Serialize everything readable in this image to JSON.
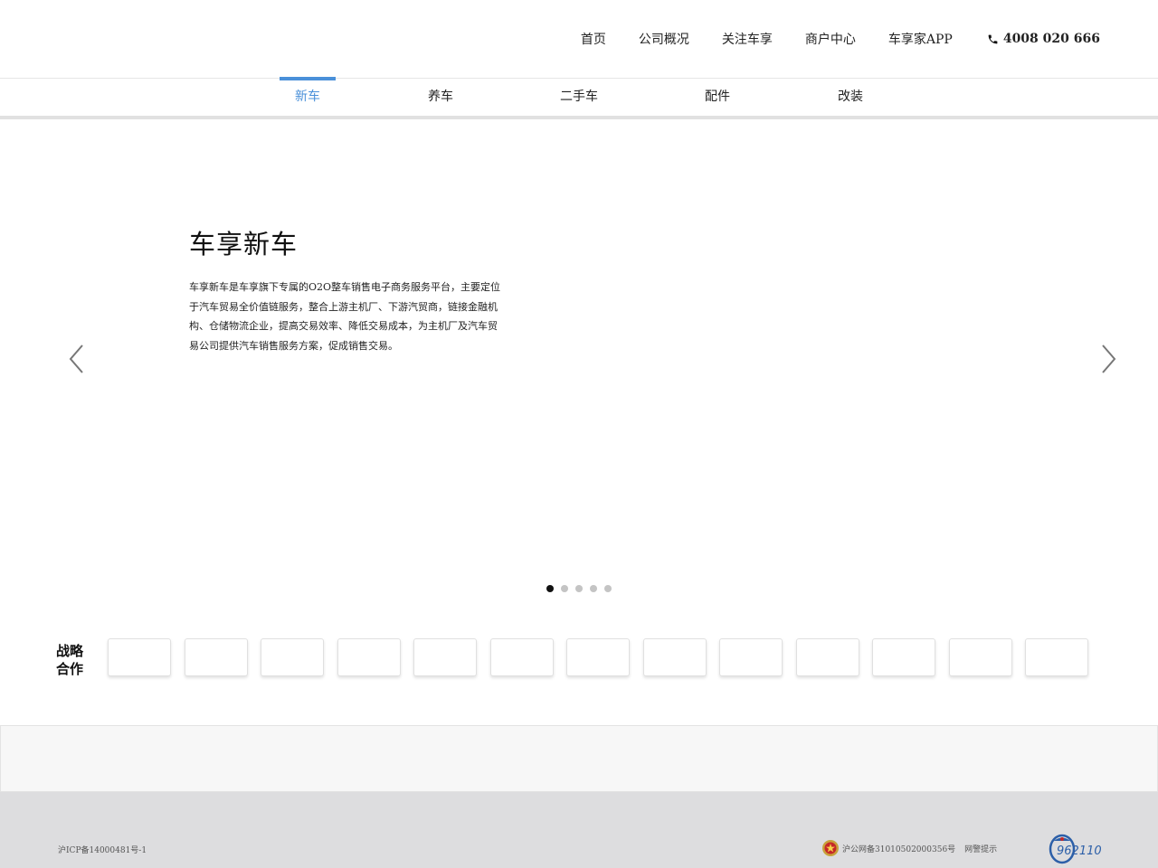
{
  "header": {
    "nav": [
      "首页",
      "公司概况",
      "关注车享",
      "商户中心",
      "车享家APP"
    ],
    "phone": "4008 020 666"
  },
  "subnav": {
    "tabs": [
      "新车",
      "养车",
      "二手车",
      "配件",
      "改装"
    ],
    "active": "新车"
  },
  "hero": {
    "title": "车享新车",
    "description": "车享新车是车享旗下专属的O2O整车销售电子商务服务平台，主要定位于汽车贸易全价值链服务，整合上游主机厂、下游汽贸商，链接金融机构、仓储物流企业，提高交易效率、降低交易成本，为主机厂及汽车贸易公司提供汽车销售服务方案，促成销售交易。",
    "slide_count": 5,
    "active_slide": 1
  },
  "partners": {
    "label": "战略合作",
    "logo_count": 13
  },
  "footer": {
    "icp": "沪ICP备14000481号-1",
    "police_record": "沪公网备31010502000356号",
    "police_tip": "网警提示",
    "badge_text": "962110"
  },
  "colors": {
    "accent": "#4a90d9",
    "footer_bg": "#dddddf",
    "links_band_bg": "#f7f7f7"
  },
  "icons": {
    "phone": "phone-icon",
    "prev": "chevron-left-icon",
    "next": "chevron-right-icon",
    "police": "police-emblem-icon",
    "badge": "962110-badge-icon"
  }
}
